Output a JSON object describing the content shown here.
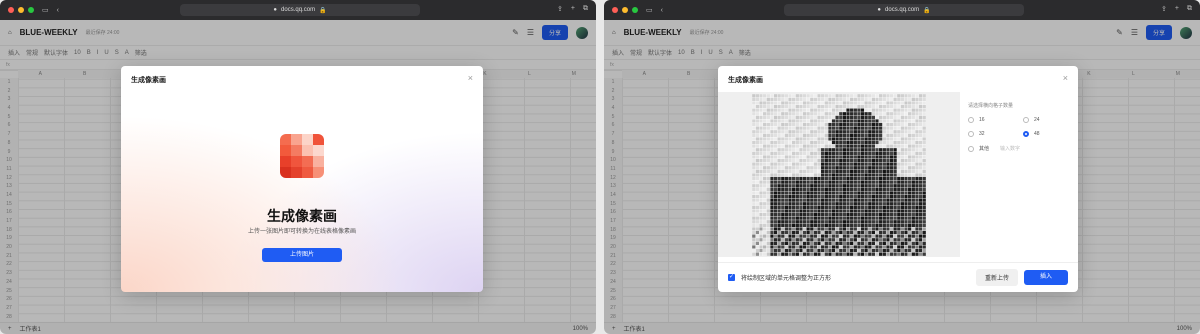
{
  "browser": {
    "url": "docs.qq.com"
  },
  "app": {
    "doc_title": "BLUE-WEEKLY",
    "save_state": "最近保存 24:00",
    "share_label": "分享",
    "toolbar_items": [
      "插入",
      "常规",
      "默认字体",
      "10",
      "B",
      "I",
      "U",
      "S",
      "A",
      "筛选"
    ],
    "columns": [
      "A",
      "B",
      "C",
      "D",
      "E",
      "F",
      "G",
      "H",
      "I",
      "J",
      "K",
      "L",
      "M"
    ],
    "rows": [
      "1",
      "2",
      "3",
      "4",
      "5",
      "6",
      "7",
      "8",
      "9",
      "10",
      "11",
      "12",
      "13",
      "14",
      "15",
      "16",
      "17",
      "18",
      "19",
      "20",
      "21",
      "22",
      "23",
      "24",
      "25",
      "26",
      "27",
      "28"
    ],
    "sheet_tab": "工作表1",
    "zoom": "100%"
  },
  "left_dialog": {
    "title": "生成像素画",
    "heading": "生成像素画",
    "subtitle": "上传一张图片即可转换为在线表格像素画",
    "upload_button": "上传图片",
    "logo_colors": [
      "#f46c4f",
      "#f9a48f",
      "#fcd4c8",
      "#f0533a",
      "#f25a3c",
      "#f47b62",
      "#fbc1b1",
      "#fcd8ce",
      "#e8402a",
      "#f0553d",
      "#f36d53",
      "#f9b19f",
      "#d9311f",
      "#e4412c",
      "#ef5a40",
      "#f79077"
    ]
  },
  "right_dialog": {
    "title": "生成像素画",
    "options_label": "请选择横向格子数量",
    "options": [
      {
        "label": "16",
        "selected": false
      },
      {
        "label": "24",
        "selected": false
      },
      {
        "label": "32",
        "selected": false
      },
      {
        "label": "48",
        "selected": true
      }
    ],
    "other_label": "其他",
    "other_placeholder": "输入数字",
    "checkbox_label": "将绘制区域的单元格调整为正方形",
    "checkbox_checked": true,
    "reupload_button": "重新上传",
    "import_button": "插入"
  }
}
